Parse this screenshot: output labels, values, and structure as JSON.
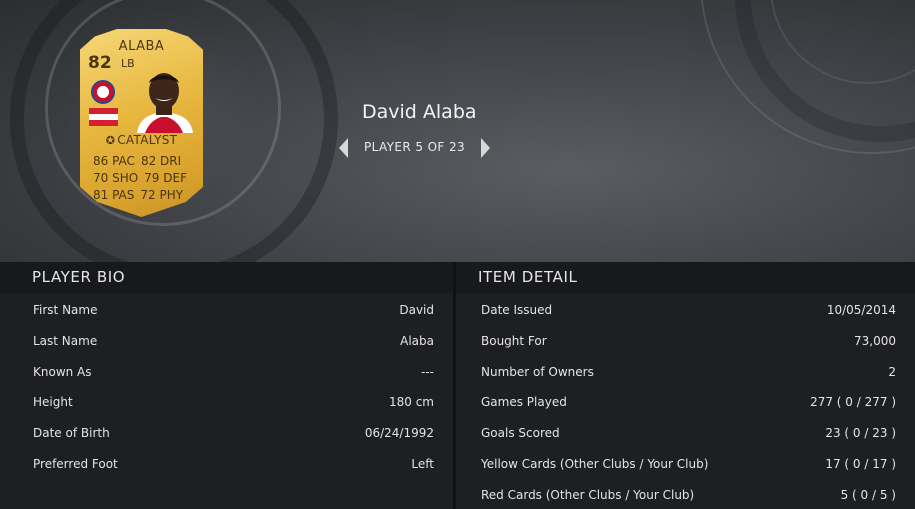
{
  "card": {
    "name": "ALABA",
    "rating": "82",
    "position": "LB",
    "perk": "CATALYST",
    "stats": [
      [
        "86 PAC",
        "82 DRI"
      ],
      [
        "70 SHO",
        "79 DEF"
      ],
      [
        "81 PAS",
        "72 PHY"
      ]
    ],
    "colors": {
      "gold_light": "#f6d777",
      "gold_dark": "#c99124"
    }
  },
  "player": {
    "name": "David Alaba",
    "pager": "PLAYER 5 OF 23"
  },
  "bio": {
    "title": "PLAYER BIO",
    "rows": [
      {
        "label": "First Name",
        "value": "David"
      },
      {
        "label": "Last Name",
        "value": "Alaba"
      },
      {
        "label": "Known As",
        "value": "---"
      },
      {
        "label": "Height",
        "value": "180 cm"
      },
      {
        "label": "Date of Birth",
        "value": "06/24/1992"
      },
      {
        "label": "Preferred Foot",
        "value": "Left"
      }
    ]
  },
  "item": {
    "title": "ITEM DETAIL",
    "rows": [
      {
        "label": "Date Issued",
        "value": "10/05/2014"
      },
      {
        "label": "Bought For",
        "value": "73,000"
      },
      {
        "label": "Number of Owners",
        "value": "2"
      },
      {
        "label": "Games Played",
        "value": "277 ( 0 / 277 )"
      },
      {
        "label": "Goals Scored",
        "value": "23 ( 0 / 23 )"
      },
      {
        "label": "Yellow Cards (Other Clubs / Your Club)",
        "value": "17 ( 0 / 17 )"
      },
      {
        "label": "Red Cards (Other Clubs / Your Club)",
        "value": "5 ( 0 / 5 )"
      }
    ]
  }
}
